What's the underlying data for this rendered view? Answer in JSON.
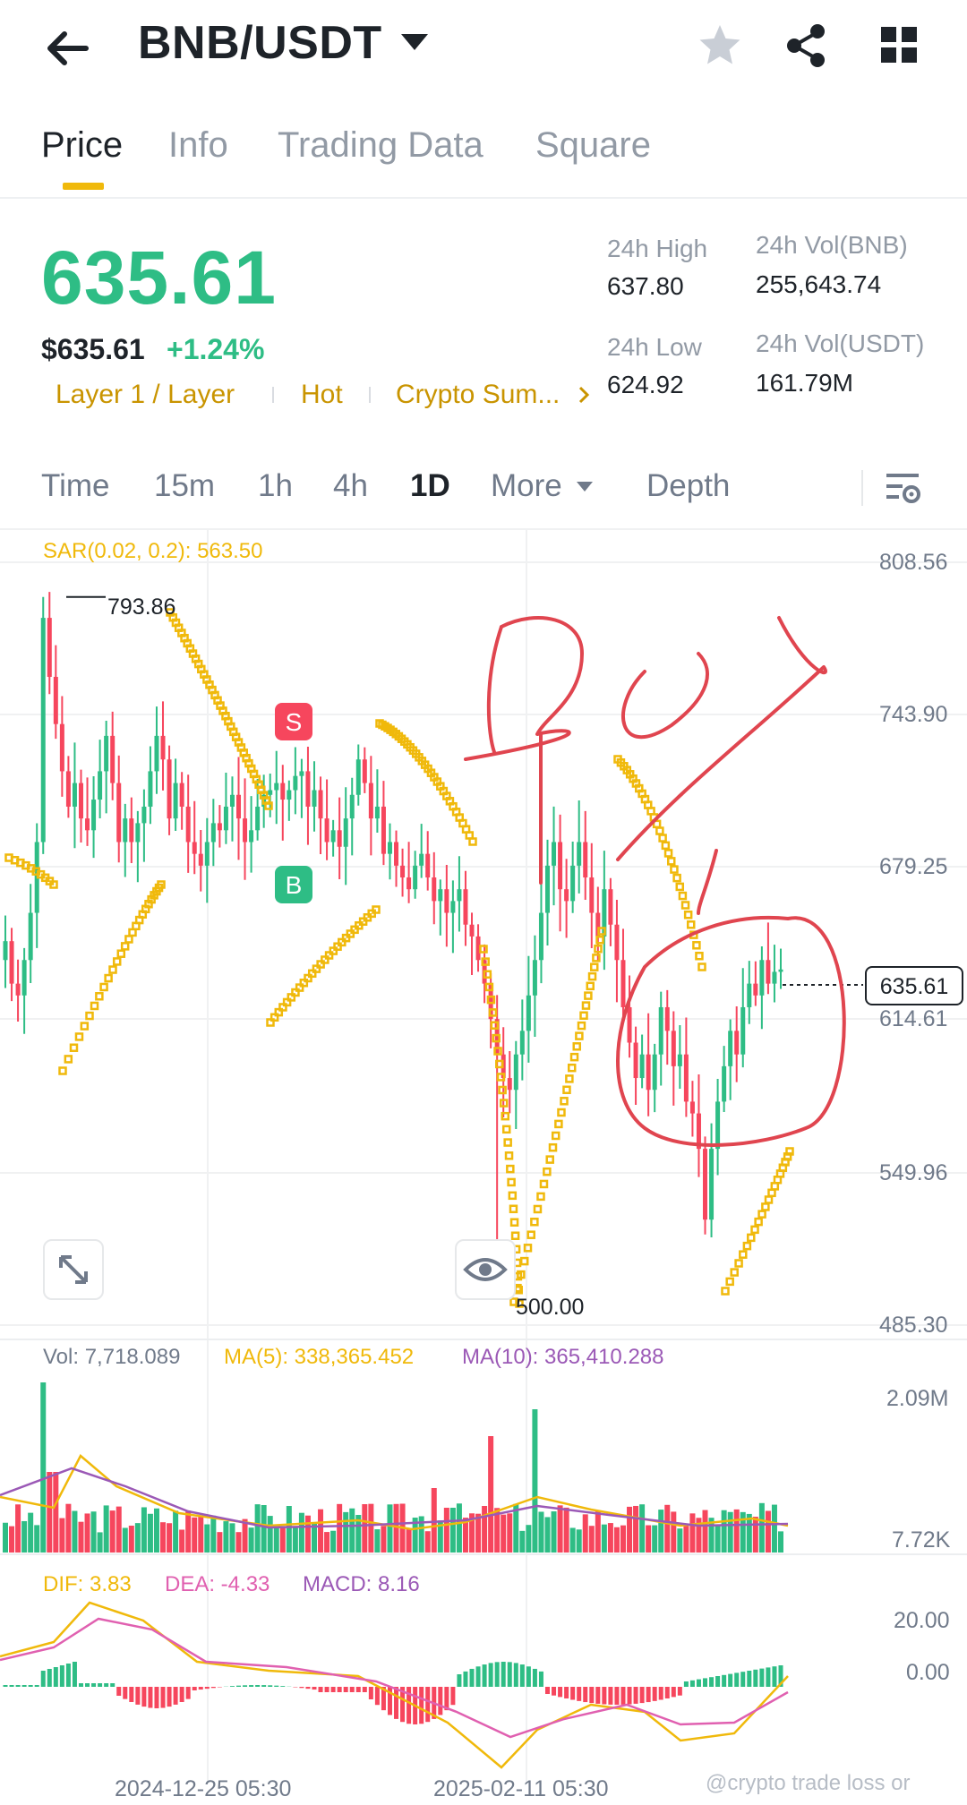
{
  "header": {
    "pair": "BNB/USDT",
    "back_icon": "arrow-left-icon",
    "star_icon": "star-icon",
    "share_icon": "share-icon",
    "grid_icon": "grid-icon"
  },
  "tabs": [
    {
      "label": "Price",
      "active": true
    },
    {
      "label": "Info",
      "active": false
    },
    {
      "label": "Trading Data",
      "active": false
    },
    {
      "label": "Square",
      "active": false
    }
  ],
  "ticker": {
    "last_price": "635.61",
    "usd_price": "$635.61",
    "change": "+1.24%",
    "tags": [
      "Layer 1 / Layer",
      "Hot",
      "Crypto Sum..."
    ],
    "stats": {
      "high_label": "24h High",
      "high_value": "637.80",
      "low_label": "24h Low",
      "low_value": "624.92",
      "vol_bnb_label": "24h Vol(BNB)",
      "vol_bnb_value": "255,643.74",
      "vol_usdt_label": "24h Vol(USDT)",
      "vol_usdt_value": "161.79M"
    }
  },
  "intervals": {
    "items": [
      "Time",
      "15m",
      "1h",
      "4h",
      "1D",
      "More",
      "Depth"
    ],
    "active": "1D"
  },
  "colors": {
    "up": "#2ebd85",
    "down": "#f6465d",
    "sar": "#f0b90b",
    "ma5": "#f0b90b",
    "ma10": "#9b59b6",
    "accent": "#f0b90b",
    "annotation": "#e0454f"
  },
  "indicators": {
    "sar": "SAR(0.02, 0.2): 563.50",
    "vol": "Vol: 7,718.089",
    "ma5": "MA(5): 338,365.452",
    "ma10": "MA(10): 365,410.288",
    "dif": "DIF: 3.83",
    "dea": "DEA: -4.33",
    "macd": "MACD: 8.16"
  },
  "chart_data": {
    "type": "candlestick",
    "price_axis": [
      "808.56",
      "743.90",
      "679.25",
      "614.61",
      "549.96",
      "485.30"
    ],
    "current_price": "635.61",
    "high_marker": "793.86",
    "low_marker": "500.00",
    "volume_axis": [
      "2.09M",
      "7.72K"
    ],
    "macd_axis": [
      "20.00",
      "0.00"
    ],
    "x_labels": [
      "2024-12-25 05:30",
      "2025-02-11 05:30"
    ],
    "signals": [
      {
        "label": "S",
        "type": "sell"
      },
      {
        "label": "B",
        "type": "buy"
      }
    ],
    "annotation_text": "BUY",
    "close_path": [
      648,
      630,
      625,
      640,
      660,
      690,
      785,
      760,
      740,
      720,
      705,
      715,
      700,
      695,
      708,
      720,
      735,
      715,
      690,
      700,
      690,
      698,
      705,
      720,
      735,
      725,
      700,
      715,
      705,
      690,
      685,
      680,
      690,
      698,
      695,
      705,
      710,
      700,
      690,
      695,
      705,
      710,
      712,
      715,
      708,
      712,
      718,
      720,
      705,
      712,
      700,
      690,
      695,
      688,
      700,
      710,
      725,
      715,
      700,
      705,
      685,
      690,
      680,
      675,
      670,
      680,
      685,
      675,
      665,
      670,
      660,
      665,
      670,
      655,
      650,
      640,
      630,
      615,
      600,
      590,
      585,
      600,
      610,
      625,
      640,
      660,
      680,
      690,
      670,
      665,
      680,
      690,
      675,
      660,
      650,
      670,
      655,
      640,
      620,
      605,
      590,
      600,
      585,
      600,
      620,
      610,
      595,
      600,
      580,
      575,
      560,
      530,
      560,
      580,
      595,
      610,
      600,
      620,
      630,
      625,
      640,
      630,
      635,
      636
    ]
  },
  "watermark": "@crypto trade loss or"
}
